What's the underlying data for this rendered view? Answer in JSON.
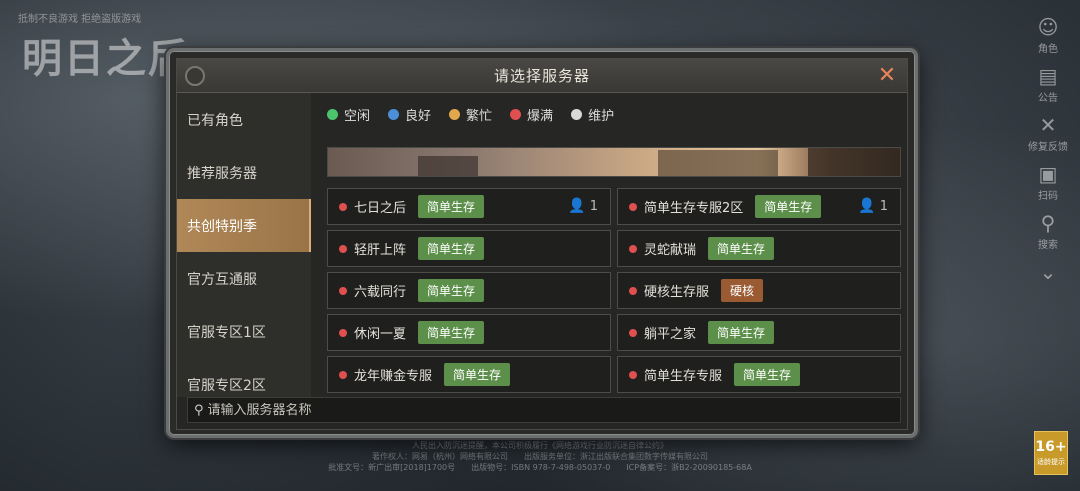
{
  "dialog": {
    "title": "请选择服务器",
    "close_icon": "close-icon"
  },
  "sidebar": {
    "items": [
      {
        "label": "已有角色",
        "active": false
      },
      {
        "label": "推荐服务器",
        "active": false
      },
      {
        "label": "共创特别季",
        "active": true
      },
      {
        "label": "官方互通服",
        "active": false
      },
      {
        "label": "官服专区1区",
        "active": false
      },
      {
        "label": "官服专区2区",
        "active": false
      }
    ]
  },
  "legend": [
    {
      "label": "空闲",
      "color": "#4cc46c"
    },
    {
      "label": "良好",
      "color": "#4a8fd8"
    },
    {
      "label": "繁忙",
      "color": "#e0a84a"
    },
    {
      "label": "爆满",
      "color": "#e05050"
    },
    {
      "label": "维护",
      "color": "#d8d8d8"
    }
  ],
  "servers": [
    {
      "name": "七日之后",
      "tag": "简单生存",
      "tag_color": "#5c8f4a",
      "count": "1",
      "status_color": "#e05050"
    },
    {
      "name": "简单生存专服2区",
      "tag": "简单生存",
      "tag_color": "#5c8f4a",
      "count": "1",
      "status_color": "#e05050"
    },
    {
      "name": "轻肝上阵",
      "tag": "简单生存",
      "tag_color": "#5c8f4a",
      "count": "",
      "status_color": "#e05050"
    },
    {
      "name": "灵蛇献瑞",
      "tag": "简单生存",
      "tag_color": "#5c8f4a",
      "count": "",
      "status_color": "#e05050"
    },
    {
      "name": "六载同行",
      "tag": "简单生存",
      "tag_color": "#5c8f4a",
      "count": "",
      "status_color": "#e05050"
    },
    {
      "name": "硬核生存服",
      "tag": "硬核",
      "tag_color": "#9a5a32",
      "count": "",
      "status_color": "#e05050"
    },
    {
      "name": "休闲一夏",
      "tag": "简单生存",
      "tag_color": "#5c8f4a",
      "count": "",
      "status_color": "#e05050"
    },
    {
      "name": "躺平之家",
      "tag": "简单生存",
      "tag_color": "#5c8f4a",
      "count": "",
      "status_color": "#e05050"
    },
    {
      "name": "龙年赚金专服",
      "tag": "简单生存",
      "tag_color": "#5c8f4a",
      "count": "",
      "status_color": "#e05050"
    },
    {
      "name": "简单生存专服",
      "tag": "简单生存",
      "tag_color": "#5c8f4a",
      "count": "",
      "status_color": "#e05050"
    }
  ],
  "search": {
    "placeholder": "请输入服务器名称"
  },
  "background": {
    "logo": "明日之后",
    "right_rail": [
      {
        "label": "角色",
        "icon": "user-icon"
      },
      {
        "label": "公告",
        "icon": "notice-icon"
      },
      {
        "label": "修复反馈",
        "icon": "wrench-icon"
      },
      {
        "label": "扫码",
        "icon": "qrcode-icon"
      },
      {
        "label": "搜索",
        "icon": "search-icon"
      },
      {
        "label": "",
        "icon": "chevron-down-icon"
      }
    ],
    "age_rating": "16+",
    "age_rating_sub": "适龄提示",
    "footer_lines": [
      "人民出入防沉迷提醒，本公司积极履行《网络游戏行业防沉迷自律公约》",
      "著作权人：网易（杭州）网络有限公司　　出版服务单位：浙江出版联合集团数字传媒有限公司",
      "批准文号：新广出审[2018]1700号　　出版物号：ISBN 978-7-498-05037-0　　ICP备案号：浙B2-20090185-68A"
    ]
  }
}
